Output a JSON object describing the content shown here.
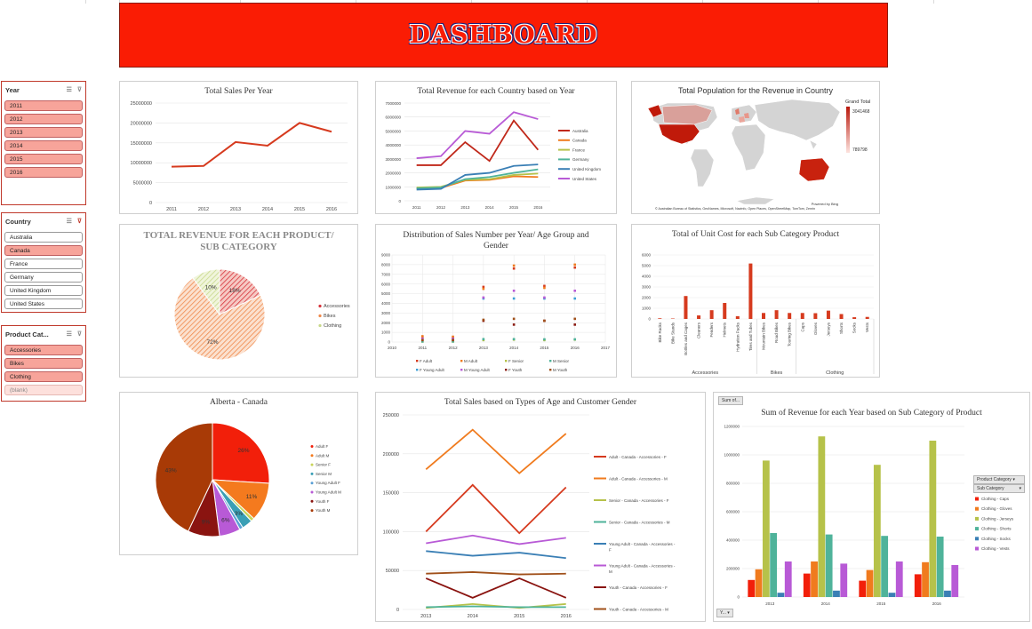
{
  "dashboard_title": "DASHBOARD",
  "slicers": {
    "year": {
      "title": "Year",
      "items": [
        {
          "label": "2011",
          "selected": true
        },
        {
          "label": "2012",
          "selected": true
        },
        {
          "label": "2013",
          "selected": true
        },
        {
          "label": "2014",
          "selected": true
        },
        {
          "label": "2015",
          "selected": true
        },
        {
          "label": "2016",
          "selected": true
        }
      ]
    },
    "country": {
      "title": "Country",
      "items": [
        {
          "label": "Australia",
          "selected": false
        },
        {
          "label": "Canada",
          "selected": true
        },
        {
          "label": "France",
          "selected": false
        },
        {
          "label": "Germany",
          "selected": false
        },
        {
          "label": "United Kingdom",
          "selected": false
        },
        {
          "label": "United States",
          "selected": false
        }
      ]
    },
    "product_category": {
      "title": "Product Cat...",
      "items": [
        {
          "label": "Accessories",
          "selected": true
        },
        {
          "label": "Bikes",
          "selected": true
        },
        {
          "label": "Clothing",
          "selected": true
        },
        {
          "label": "(blank)",
          "selected": false,
          "blank": true
        }
      ]
    }
  },
  "map_panel": {
    "title": "Total Population for the Revenue in Country",
    "legend_title": "Grand Total",
    "legend_max": "3041468",
    "legend_min": "789798",
    "powered_by": "Powered by Bing",
    "attribution": "© Australian Bureau of Statistics, GeoNames, Microsoft, Navinfo, Open Places, OpenStreetMap, TomTom, Zenrin"
  },
  "pivot_buttons": {
    "sum_of": "Sum of...",
    "product_category": "Product Category",
    "sub_category": "Sub Category",
    "year": "Y..."
  },
  "colors": {
    "banner_red": "#fa1c04",
    "line_red": "#d63a1e"
  },
  "chart_data": [
    {
      "id": "total-sales-per-year",
      "type": "line",
      "title": "Total Sales Per Year",
      "categories": [
        "2011",
        "2012",
        "2013",
        "2014",
        "2015",
        "2016"
      ],
      "series": [
        {
          "values": [
            9000000,
            9200000,
            15200000,
            14300000,
            20000000,
            17800000
          ],
          "color": "#d63a1e"
        }
      ],
      "ylim": [
        0,
        25000000
      ],
      "yticks": [
        "0",
        "5000000",
        "10000000",
        "15000000",
        "20000000",
        "25000000"
      ]
    },
    {
      "id": "revenue-country-year",
      "type": "line",
      "title": "Total Revenue for each Country based on Year",
      "categories": [
        "2011",
        "2012",
        "2013",
        "2014",
        "2015",
        "2016"
      ],
      "ylim": [
        0,
        7000000
      ],
      "yticks": [
        "0",
        "1000000",
        "2000000",
        "3000000",
        "4000000",
        "5000000",
        "6000000",
        "7000000"
      ],
      "series": [
        {
          "name": "Australia",
          "color": "#c0281a",
          "values": [
            2550000,
            2550000,
            4200000,
            2850000,
            5750000,
            3650000
          ]
        },
        {
          "name": "Canada",
          "color": "#f07b1e",
          "values": [
            880000,
            920000,
            1450000,
            1500000,
            1750000,
            1700000
          ]
        },
        {
          "name": "France",
          "color": "#b6c24a",
          "values": [
            950000,
            1000000,
            1500000,
            1550000,
            1850000,
            1950000
          ]
        },
        {
          "name": "Germany",
          "color": "#4fb39a",
          "values": [
            900000,
            950000,
            1550000,
            1700000,
            2000000,
            2250000
          ]
        },
        {
          "name": "United Kingdom",
          "color": "#3a7fb5",
          "values": [
            800000,
            850000,
            1850000,
            2000000,
            2500000,
            2600000
          ]
        },
        {
          "name": "United States",
          "color": "#b85ad6",
          "values": [
            3050000,
            3200000,
            5000000,
            4800000,
            6350000,
            5850000
          ]
        }
      ]
    },
    {
      "id": "revenue-product-subcategory",
      "type": "pie",
      "title": "TOTAL REVENUE FOR EACH PRODUCT/ SUB CATEGORY",
      "slices": [
        {
          "label": "Accessories",
          "value": 18,
          "display": "18%",
          "color": "#d6333a"
        },
        {
          "label": "Bikes",
          "value": 72,
          "display": "72%",
          "color": "#f0884a"
        },
        {
          "label": "Clothing",
          "value": 10,
          "display": "10%",
          "color": "#c8d88a"
        }
      ]
    },
    {
      "id": "distribution-age-gender",
      "type": "scatter",
      "title": "Distribution of Sales Number per Year/ Age Group and Gender",
      "xlim": [
        2010,
        2017
      ],
      "xticks": [
        "2010",
        "2011",
        "2012",
        "2013",
        "2014",
        "2015",
        "2016",
        "2017"
      ],
      "ylim": [
        0,
        9000
      ],
      "yticks": [
        "0",
        "1000",
        "2000",
        "3000",
        "4000",
        "5000",
        "6000",
        "7000",
        "8000",
        "9000"
      ],
      "series": [
        {
          "name": "F Adult",
          "color": "#d63a1e",
          "points": [
            [
              2011,
              500
            ],
            [
              2012,
              450
            ],
            [
              2013,
              5700
            ],
            [
              2014,
              7600
            ],
            [
              2015,
              5800
            ],
            [
              2016,
              7700
            ]
          ]
        },
        {
          "name": "M Adult",
          "color": "#f07b1e",
          "points": [
            [
              2011,
              600
            ],
            [
              2012,
              550
            ],
            [
              2013,
              5500
            ],
            [
              2014,
              7900
            ],
            [
              2015,
              5600
            ],
            [
              2016,
              8000
            ]
          ]
        },
        {
          "name": "F Senior",
          "color": "#b6c24a",
          "points": [
            [
              2011,
              50
            ],
            [
              2012,
              50
            ],
            [
              2013,
              200
            ],
            [
              2014,
              250
            ],
            [
              2015,
              200
            ],
            [
              2016,
              250
            ]
          ]
        },
        {
          "name": "M Senior",
          "color": "#4fb39a",
          "points": [
            [
              2011,
              60
            ],
            [
              2012,
              60
            ],
            [
              2013,
              300
            ],
            [
              2014,
              300
            ],
            [
              2015,
              280
            ],
            [
              2016,
              280
            ]
          ]
        },
        {
          "name": "F Young Adult",
          "color": "#3a9fd6",
          "points": [
            [
              2011,
              300
            ],
            [
              2012,
              300
            ],
            [
              2013,
              4500
            ],
            [
              2014,
              4500
            ],
            [
              2015,
              4500
            ],
            [
              2016,
              4500
            ]
          ]
        },
        {
          "name": "M Young Adult",
          "color": "#b85ad6",
          "points": [
            [
              2011,
              350
            ],
            [
              2012,
              350
            ],
            [
              2013,
              4600
            ],
            [
              2014,
              5300
            ],
            [
              2015,
              4600
            ],
            [
              2016,
              5300
            ]
          ]
        },
        {
          "name": "F Youth",
          "color": "#8a1a10",
          "points": [
            [
              2011,
              200
            ],
            [
              2012,
              200
            ],
            [
              2013,
              2200
            ],
            [
              2014,
              1800
            ],
            [
              2015,
              2200
            ],
            [
              2016,
              1800
            ]
          ]
        },
        {
          "name": "M Youth",
          "color": "#a0501a",
          "points": [
            [
              2011,
              220
            ],
            [
              2012,
              220
            ],
            [
              2013,
              2300
            ],
            [
              2014,
              2400
            ],
            [
              2015,
              2200
            ],
            [
              2016,
              2400
            ]
          ]
        }
      ]
    },
    {
      "id": "unit-cost-subcategory",
      "type": "bar",
      "title": "Total of Unit Cost for each Sub Category Product",
      "ylim": [
        0,
        6000
      ],
      "yticks": [
        "0",
        "500",
        "1000",
        "1500",
        "2000",
        "2500",
        "3000",
        "3500",
        "4000",
        "4500",
        "5000",
        "5500",
        "6000"
      ],
      "groups": [
        {
          "name": "Accessories",
          "categories": [
            "Bike Racks",
            "Bike Stands",
            "Bottles and Cages",
            "Cleaners",
            "Fenders",
            "Helmets",
            "Hydration Packs",
            "Tires and Tubes"
          ],
          "values": [
            60,
            40,
            2150,
            330,
            820,
            1500,
            260,
            5200
          ]
        },
        {
          "name": "Bikes",
          "categories": [
            "Mountain Bikes",
            "Road Bikes",
            "Touring Bikes"
          ],
          "values": [
            560,
            820,
            560
          ]
        },
        {
          "name": "Clothing",
          "categories": [
            "Caps",
            "Gloves",
            "Jerseys",
            "Shorts",
            "Socks",
            "Vests"
          ],
          "values": [
            560,
            540,
            780,
            460,
            160,
            190
          ]
        }
      ],
      "color": "#d63a1e"
    },
    {
      "id": "alberta-canada",
      "type": "pie",
      "title": "Alberta - Canada",
      "slices": [
        {
          "label": "Adult F",
          "value": 26,
          "display": "26%",
          "color": "#f21f0a"
        },
        {
          "label": "Adult M",
          "value": 11,
          "display": "11%",
          "color": "#f47a1e"
        },
        {
          "label": "Senior F",
          "value": 1,
          "display": "",
          "color": "#c9d45a"
        },
        {
          "label": "Senior M",
          "value": 3,
          "display": "3%",
          "color": "#3a9fb5"
        },
        {
          "label": "Young Adult F",
          "value": 1,
          "display": "",
          "color": "#5aa0d6"
        },
        {
          "label": "Young Adult M",
          "value": 6,
          "display": "6%",
          "color": "#b85ad6"
        },
        {
          "label": "Youth F",
          "value": 9,
          "display": "9%",
          "color": "#8a1410"
        },
        {
          "label": "Youth M",
          "value": 43,
          "display": "43%",
          "color": "#a83a06"
        }
      ]
    },
    {
      "id": "sales-age-gender",
      "type": "line",
      "title": "Total Sales based on Types of Age and Customer Gender",
      "categories": [
        "2013",
        "2014",
        "2015",
        "2016"
      ],
      "ylim": [
        0,
        250000
      ],
      "yticks": [
        "0",
        "50000",
        "100000",
        "150000",
        "200000",
        "250000"
      ],
      "series": [
        {
          "name": "Adult - Canada - Accessories - F",
          "color": "#d63a1e",
          "values": [
            100000,
            160000,
            98000,
            157000
          ]
        },
        {
          "name": "Adult - Canada - Accessories - M",
          "color": "#f07b1e",
          "values": [
            180000,
            231000,
            175000,
            226000
          ]
        },
        {
          "name": "Senior - Canada - Accessories - F",
          "color": "#b6c24a",
          "values": [
            2000,
            7000,
            2000,
            7000
          ]
        },
        {
          "name": "Senior - Canada - Accessories - M",
          "color": "#4fb39a",
          "values": [
            3000,
            4000,
            3000,
            3000
          ]
        },
        {
          "name": "Young Adult - Canada - Accessories - F",
          "color": "#3a7fb5",
          "values": [
            75000,
            69000,
            73000,
            66000
          ]
        },
        {
          "name": "Young Adult - Canada - Accessories - M",
          "color": "#b85ad6",
          "values": [
            85000,
            95000,
            84000,
            92000
          ]
        },
        {
          "name": "Youth - Canada - Accessories - F",
          "color": "#8a1410",
          "values": [
            40000,
            15000,
            40000,
            15000
          ]
        },
        {
          "name": "Youth - Canada - Accessories - M",
          "color": "#a0501a",
          "values": [
            46000,
            48000,
            45000,
            46000
          ]
        }
      ]
    },
    {
      "id": "revenue-year-subcategory",
      "type": "bar",
      "title": "Sum of Revenue for each Year based on Sub Category of Product",
      "categories": [
        "2013",
        "2014",
        "2015",
        "2016"
      ],
      "ylim": [
        0,
        1200000
      ],
      "yticks": [
        "0",
        "200000",
        "400000",
        "600000",
        "800000",
        "1000000",
        "1200000"
      ],
      "series": [
        {
          "name": "Clothing - Caps",
          "color": "#f21f0a",
          "values": [
            120000,
            165000,
            115000,
            160000
          ]
        },
        {
          "name": "Clothing - Gloves",
          "color": "#f07b1e",
          "values": [
            195000,
            250000,
            190000,
            245000
          ]
        },
        {
          "name": "Clothing - Jerseys",
          "color": "#b6c24a",
          "values": [
            960000,
            1130000,
            930000,
            1100000
          ]
        },
        {
          "name": "Clothing - Shorts",
          "color": "#4fb39a",
          "values": [
            450000,
            440000,
            430000,
            425000
          ]
        },
        {
          "name": "Clothing - Socks",
          "color": "#3a7fb5",
          "values": [
            30000,
            45000,
            30000,
            45000
          ]
        },
        {
          "name": "Clothing - Vests",
          "color": "#b85ad6",
          "values": [
            250000,
            235000,
            250000,
            225000
          ]
        }
      ]
    }
  ]
}
